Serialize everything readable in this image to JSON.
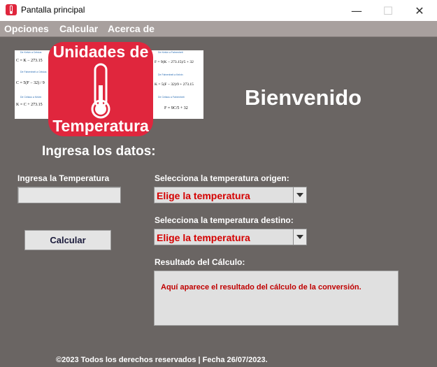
{
  "window": {
    "title": "Pantalla principal",
    "minimize_glyph": "—",
    "maximize_glyph": "☐",
    "close_glyph": "✕"
  },
  "menu": {
    "items": [
      "Opciones",
      "Calcular",
      "Acerca de"
    ]
  },
  "banner": {
    "title_line1": "Unidades de",
    "title_line2": "Temperatura",
    "left_formulas": [
      {
        "caption": "De Kelvin a Celsius",
        "formula": "C = K − 273.15"
      },
      {
        "caption": "De Fahrenheit a Celsius",
        "formula": "C = 5(F − 32) / 9"
      },
      {
        "caption": "De Celsius a Kelvin",
        "formula": "K = C + 273.15"
      }
    ],
    "right_formulas": [
      {
        "caption": "De Kelvin a Fahrenheit",
        "formula": "F = 9(K − 273.15)/5 + 32"
      },
      {
        "caption": "De Fahrenheit a Kelvin",
        "formula": "K = 5(F − 32)/9 + 273.15"
      },
      {
        "caption": "De Celsius a Fahrenheit",
        "formula": "F = 9C/5 + 32"
      }
    ],
    "accent": "#e0263d"
  },
  "main": {
    "welcome": "Bienvenido",
    "heading": "Ingresa los datos:",
    "input_label": "Ingresa la Temperatura",
    "input_value": "",
    "calc_button": "Calcular",
    "origin_label": "Selecciona la temperatura origen:",
    "origin_selected": "Elige la temperatura",
    "dest_label": "Selecciona la temperatura destino:",
    "dest_selected": "Elige la temperatura",
    "result_label": "Resultado del Cálculo:",
    "result_text": "Aquí aparece el resultado del cálculo de la conversión."
  },
  "footer": {
    "text": "©2023 Todos los derechos reservados | Fecha 26/07/2023."
  },
  "colors": {
    "background": "#6a6563",
    "menubar": "#a8a09e",
    "combo_text": "#d40000",
    "result_text": "#c00000"
  }
}
